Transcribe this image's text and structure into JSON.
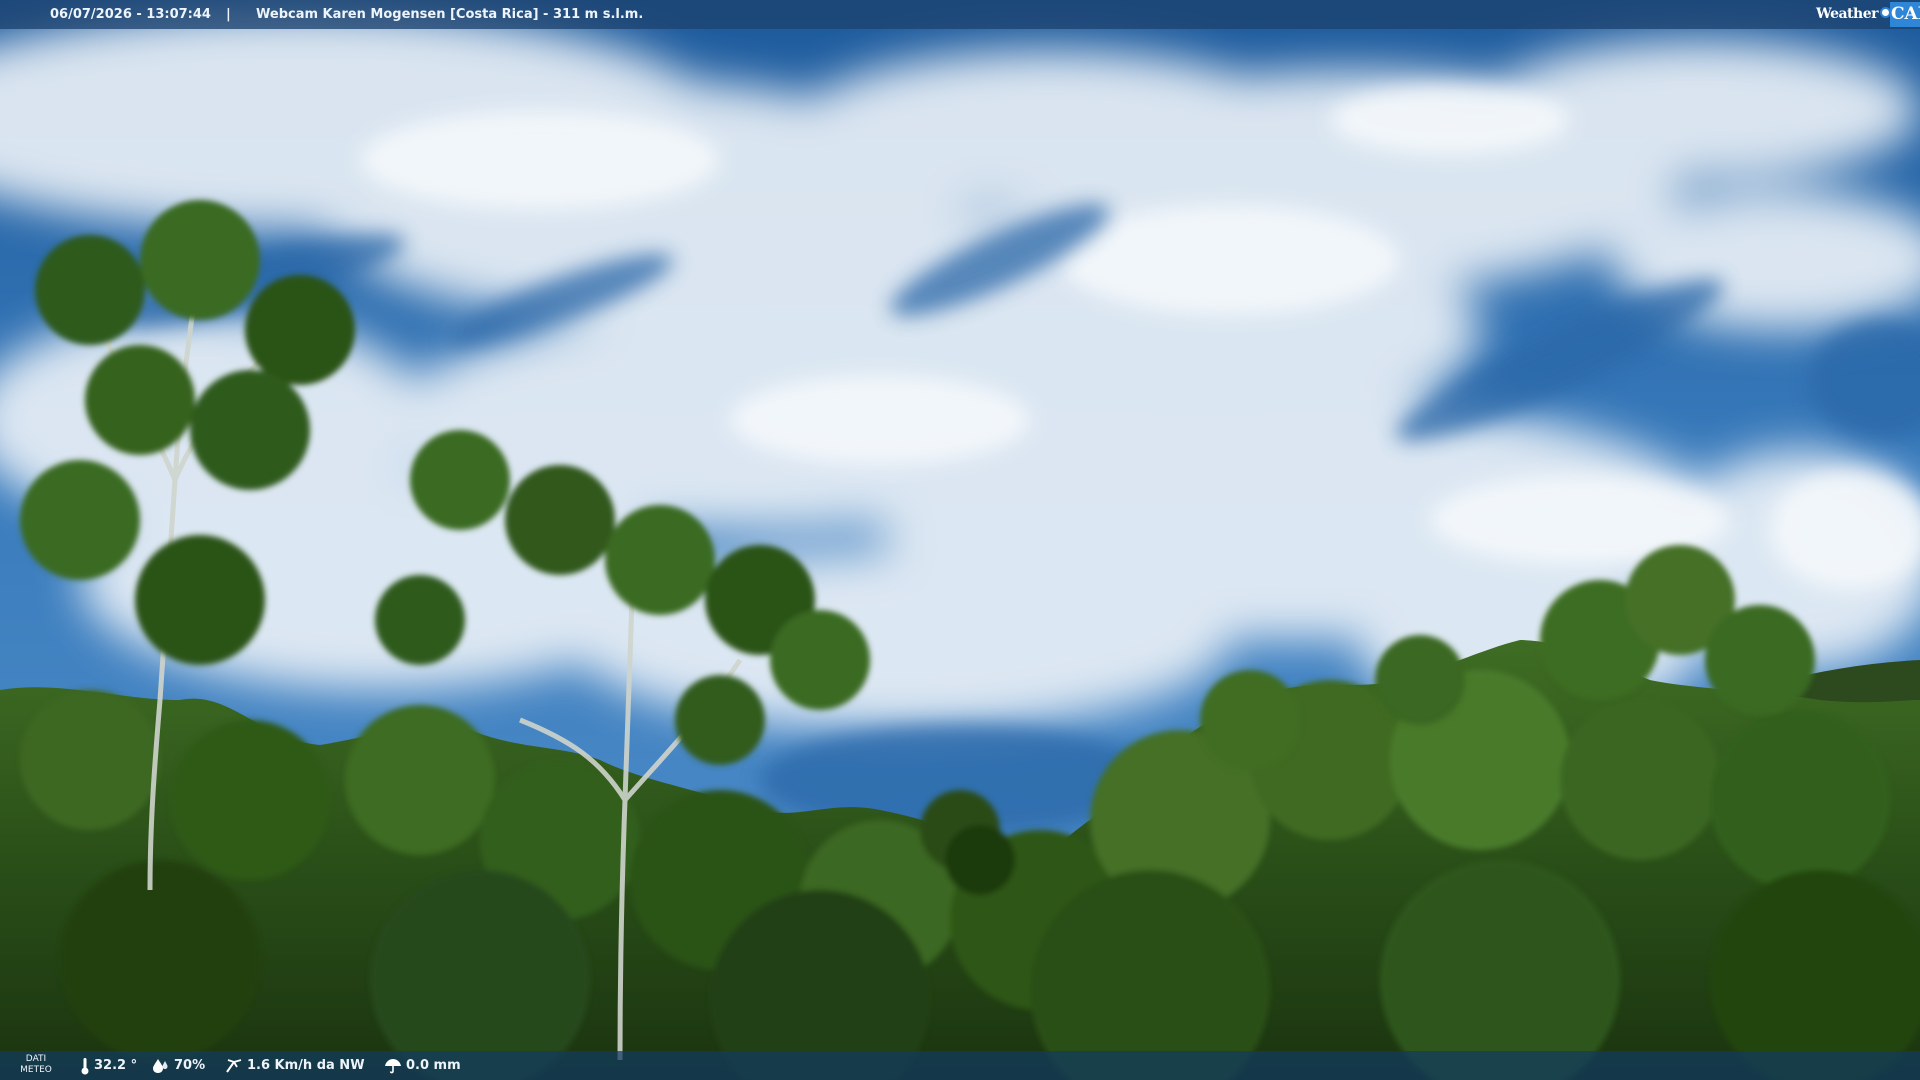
{
  "overlay": {
    "datetime": "06/07/2026 - 13:07:44",
    "separator": "|",
    "location": "Webcam Karen Mogensen [Costa Rica]  - 311 m s.l.m.",
    "logo_weather": "Weather",
    "logo_cam": "CAM"
  },
  "weather": {
    "label_line1": "DATI",
    "label_line2": "METEO",
    "temperature": "32.2 °",
    "humidity": "70%",
    "wind": "1.6 Km/h da NW",
    "rain": "0.0 mm",
    "icons": [
      "thermometer-icon",
      "humidity-drop-icon",
      "wind-icon",
      "rain-umbrella-icon"
    ]
  },
  "scene": {
    "description_colors": {
      "sky_top": "#1f5c9e",
      "sky_mid": "#3d7fc0",
      "cloud": "#eaf1f8",
      "forest_dark": "#1f3d14",
      "forest_light": "#4e7f2c"
    }
  }
}
